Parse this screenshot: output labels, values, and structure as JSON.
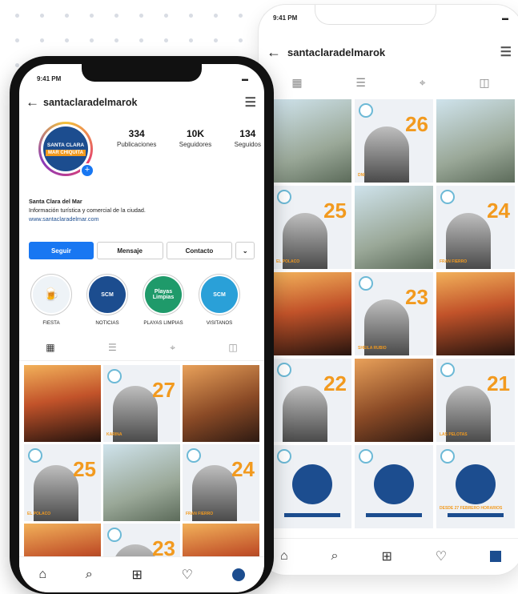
{
  "status_time": "9:41 PM",
  "username": "santaclaradelmarok",
  "avatar": {
    "line1": "SANTA CLARA",
    "line2": "MAR CHIQUITA"
  },
  "stats": [
    {
      "value": "334",
      "label": "Publicaciones"
    },
    {
      "value": "10K",
      "label": "Seguidores"
    },
    {
      "value": "134",
      "label": "Seguidos"
    }
  ],
  "bio": {
    "name": "Santa Clara del Mar",
    "description": "Información turística y comercial de la ciudad.",
    "link": "www.santaclaradelmar.com"
  },
  "actions": {
    "follow": "Seguir",
    "message": "Mensaje",
    "contact": "Contacto",
    "more": "⌄"
  },
  "highlights": [
    {
      "label": "FIESTA",
      "text": "🍺",
      "color": "#eef3f7"
    },
    {
      "label": "NOTICIAS",
      "text": "SCM",
      "color": "#1c4d8f"
    },
    {
      "label": "PLAYAS LIMPIAS",
      "text": "Playas Limpias",
      "color": "#1f9a6a"
    },
    {
      "label": "VISITANOS",
      "text": "SCM",
      "color": "#2aa0d8"
    }
  ],
  "front_grid": [
    {
      "kind": "concert",
      "number": "",
      "label": ""
    },
    {
      "kind": "num",
      "number": "27",
      "label": "KARINA"
    },
    {
      "kind": "photo",
      "number": "",
      "label": ""
    },
    {
      "kind": "num",
      "number": "25",
      "label": "EL POLACO"
    },
    {
      "kind": "green",
      "number": "",
      "label": ""
    },
    {
      "kind": "num",
      "number": "24",
      "label": "FRAN FIERRO"
    },
    {
      "kind": "concert",
      "number": "",
      "label": ""
    },
    {
      "kind": "num",
      "number": "23",
      "label": ""
    },
    {
      "kind": "concert",
      "number": "",
      "label": ""
    }
  ],
  "back_grid": [
    {
      "kind": "green",
      "number": "",
      "label": ""
    },
    {
      "kind": "num",
      "number": "26",
      "label": "DNI"
    },
    {
      "kind": "green",
      "number": "",
      "label": ""
    },
    {
      "kind": "num",
      "number": "25",
      "label": "EL POLACO"
    },
    {
      "kind": "green",
      "number": "",
      "label": ""
    },
    {
      "kind": "num",
      "number": "24",
      "label": "FRAN FIERRO"
    },
    {
      "kind": "concert",
      "number": "",
      "label": ""
    },
    {
      "kind": "num",
      "number": "23",
      "label": "SHEILA RUBIO"
    },
    {
      "kind": "concert",
      "number": "",
      "label": ""
    },
    {
      "kind": "num",
      "number": "22",
      "label": ""
    },
    {
      "kind": "photo",
      "number": "",
      "label": ""
    },
    {
      "kind": "num",
      "number": "21",
      "label": "LAS PELOTAS"
    },
    {
      "kind": "promo",
      "number": "",
      "label": ""
    },
    {
      "kind": "promo",
      "number": "",
      "label": ""
    },
    {
      "kind": "promo",
      "number": "",
      "label": "DESDE 27 FEBRERO HORARIOS"
    }
  ],
  "tabs": [
    "▦",
    "☰",
    "⌖",
    "◫"
  ],
  "nav_icons": [
    "⌂",
    "⌕",
    "⊞",
    "♡"
  ]
}
